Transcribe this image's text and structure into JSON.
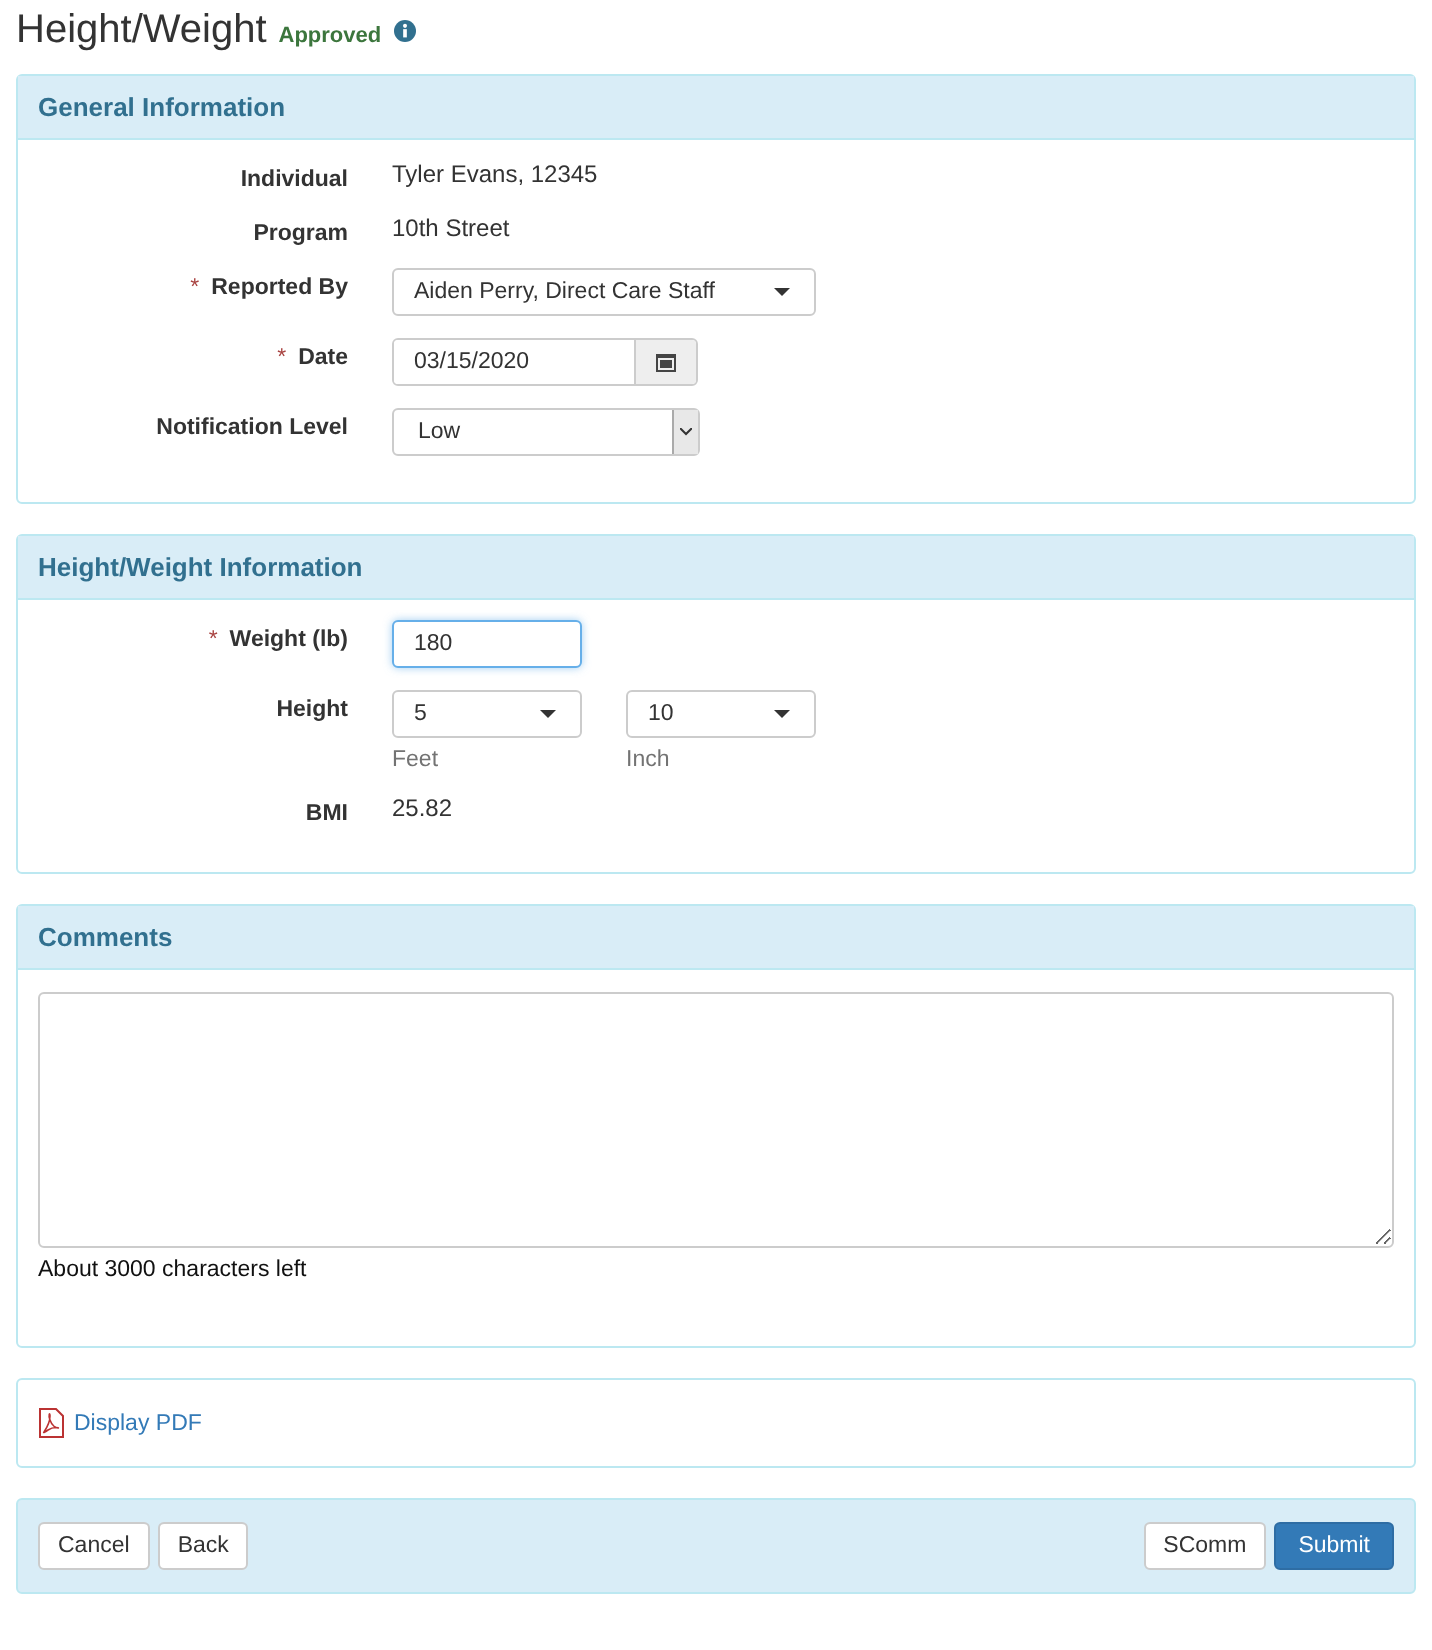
{
  "title": "Height/Weight",
  "status": "Approved",
  "general": {
    "heading": "General Information",
    "fields": [
      {
        "kind": "text",
        "label": "Individual",
        "value": "Tyler Evans, 12345"
      },
      {
        "kind": "text",
        "label": "Program",
        "value": "10th Street"
      },
      {
        "kind": "select",
        "label": "Reported By",
        "required_mark": "*",
        "value": "Aiden Perry, Direct Care Staff"
      },
      {
        "kind": "date",
        "label": "Date",
        "required_mark": "*",
        "value": "03/15/2020"
      },
      {
        "kind": "native-select",
        "label": "Notification Level",
        "value": "Low"
      }
    ]
  },
  "measurements": {
    "heading": "Height/Weight Information",
    "fields": [
      {
        "kind": "input",
        "label": "Weight (lb)",
        "required_mark": "*",
        "value": "180",
        "focused": true
      },
      {
        "kind": "split",
        "label": "Height",
        "parts": [
          {
            "value": "5",
            "caption": "Feet"
          },
          {
            "value": "10",
            "caption": "Inch"
          }
        ]
      },
      {
        "kind": "text",
        "label": "BMI",
        "value": "25.82"
      }
    ]
  },
  "comments": {
    "heading": "Comments",
    "counter": "About 3000 characters left"
  },
  "pdf_link": "Display PDF",
  "footer": {
    "left": [
      {
        "label": "Cancel",
        "primary": false
      },
      {
        "label": "Back",
        "primary": false
      }
    ],
    "right": [
      {
        "label": "SComm",
        "primary": false
      },
      {
        "label": "Submit",
        "primary": true
      }
    ]
  }
}
